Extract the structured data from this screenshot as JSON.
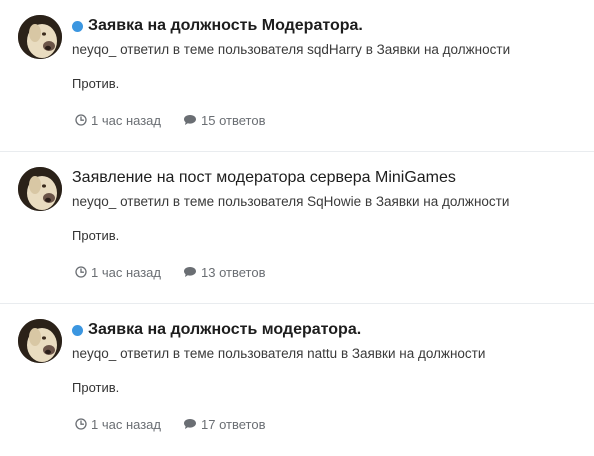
{
  "feed": {
    "items": [
      {
        "title": "Заявка на должность Модератора.",
        "user": "neyqo_",
        "action_text": "ответил в теме пользователя",
        "thread_author": "sqdHarry",
        "in_text": "в",
        "forum": "Заявки на должности",
        "snippet": "Против.",
        "time": "1 час назад",
        "replies": "15 ответов",
        "unread": true
      },
      {
        "title": "Заявление на пост модератора сервера MiniGames",
        "user": "neyqo_",
        "action_text": "ответил в теме пользователя",
        "thread_author": "SqHowie",
        "in_text": "в",
        "forum": "Заявки на должности",
        "snippet": "Против.",
        "time": "1 час назад",
        "replies": "13 ответов",
        "unread": false
      },
      {
        "title": "Заявка на должность модератора.",
        "user": "neyqo_",
        "action_text": "ответил в теме пользователя",
        "thread_author": "nattu",
        "in_text": "в",
        "forum": "Заявки на должности",
        "snippet": "Против.",
        "time": "1 час назад",
        "replies": "17 ответов",
        "unread": true
      }
    ]
  },
  "colors": {
    "unread_dot": "#3b96e0",
    "meta_icon": "#6a6e73",
    "divider": "#e9ecef"
  },
  "icons": {
    "time": "clock-icon",
    "replies": "comment-icon"
  }
}
